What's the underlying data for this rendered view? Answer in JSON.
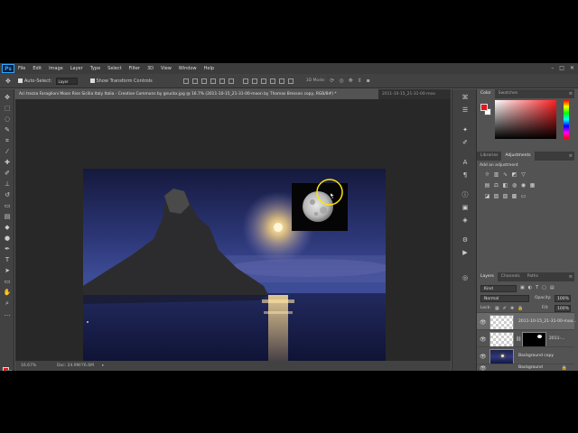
{
  "menu": {
    "logo": "Ps",
    "items": [
      "File",
      "Edit",
      "Image",
      "Layer",
      "Type",
      "Select",
      "Filter",
      "3D",
      "View",
      "Window",
      "Help"
    ],
    "window_controls": [
      "–",
      "□",
      "✕"
    ]
  },
  "options": {
    "auto_select_label": "Auto-Select:",
    "auto_select_value": "Layer",
    "show_transform_label": "Show Transform Controls",
    "mode_3d_label": "3D Mode:"
  },
  "document": {
    "active_tab": "Aci trezza Faraglioni Moon Rise Sicilia Italy Italia - Creative Commons by gnuckx.jpg @ 16.7% (2011-10-15_21-31-00-moon by Thomas Bresson copy, RGB/8#) *",
    "inactive_tab": "2011-10-15_21-31-00-moo",
    "zoom": "16.67%",
    "doc_size": "Doc: 24.9M/76.6M",
    "status_arrow": "▸"
  },
  "panels": {
    "color_tabs": [
      "Color",
      "Swatches"
    ],
    "adjust_tabs": [
      "Libraries",
      "Adjustments"
    ],
    "add_adjustment": "Add an adjustment",
    "layer_tabs": [
      "Layers",
      "Channels",
      "Paths"
    ],
    "kind": "Kind",
    "blend_mode": "Normal",
    "opacity_label": "Opacity:",
    "opacity_value": "100%",
    "lock_label": "Lock:",
    "fill_label": "Fill:",
    "fill_value": "100%",
    "layers": [
      {
        "name": "2011-10-15_21-31-00-moo..."
      },
      {
        "name": "2011-..."
      },
      {
        "name": "Background copy"
      },
      {
        "name": "Background"
      }
    ],
    "footer_icons": [
      "fx",
      "◐",
      "▣",
      "▤",
      "▢",
      "🗑"
    ]
  },
  "colors": {
    "foreground": "#e8141a",
    "background": "#ffffff"
  }
}
